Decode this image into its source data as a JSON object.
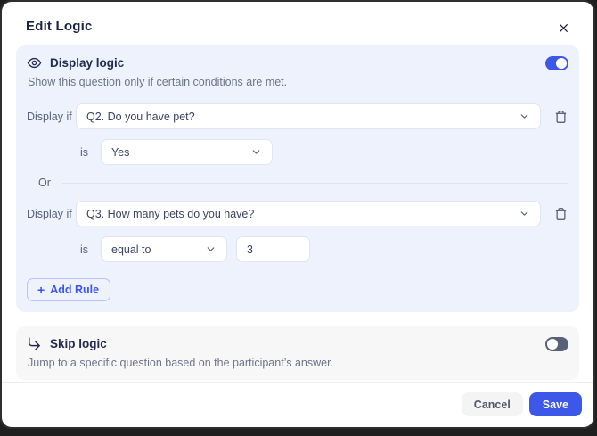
{
  "modal": {
    "title": "Edit Logic"
  },
  "display_logic": {
    "title": "Display logic",
    "description": "Show this question only if certain conditions are met.",
    "enabled": true,
    "toggle_state": "on",
    "rules": [
      {
        "condition_label": "Display if",
        "question": "Q2. Do you have pet?",
        "operator_label": "is",
        "value": "Yes"
      },
      {
        "condition_label": "Display if",
        "question": "Q3. How many pets do you have?",
        "operator_label": "is",
        "operator": "equal to",
        "value": "3"
      }
    ],
    "or_label": "Or",
    "add_rule": {
      "icon": "+",
      "label": "Add Rule"
    }
  },
  "skip_logic": {
    "title": "Skip logic",
    "description": "Jump to a specific question based on the participant’s answer.",
    "enabled": false,
    "toggle_state": "off"
  },
  "footer": {
    "cancel_label": "Cancel",
    "save_label": "Save"
  },
  "icons": [
    "close-icon",
    "eye-icon",
    "skip-arrow-icon",
    "trash-icon",
    "chevron-down-icon",
    "plus-icon"
  ],
  "colors": {
    "accent_blue": "#3d58e8",
    "display_card_bg": "#eef2fd",
    "skip_card_bg": "#f7f7f8",
    "title_navy": "#1b2142",
    "toggle_off_gray": "#5a6177",
    "backdrop": "#1f1f1f"
  }
}
